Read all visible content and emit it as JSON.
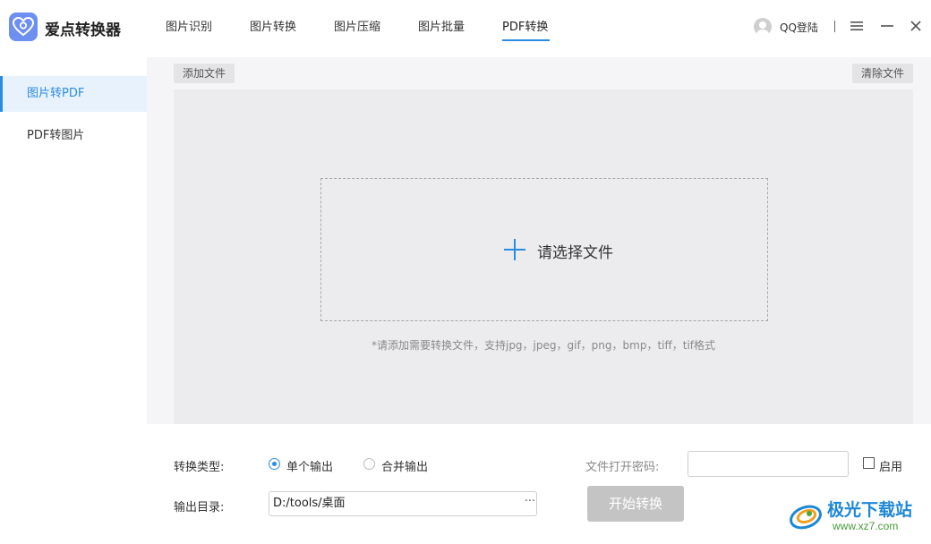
{
  "app": {
    "name": "爱点转换器",
    "brand_color": "#6c8ff0"
  },
  "nav": {
    "items": [
      {
        "label": "图片识别"
      },
      {
        "label": "图片转换"
      },
      {
        "label": "图片压缩"
      },
      {
        "label": "图片批量"
      },
      {
        "label": "PDF转换"
      }
    ],
    "active_index": 4,
    "accent_color": "#2a8ce0"
  },
  "header": {
    "login_label": "QQ登陆",
    "icons": [
      "user-avatar-icon",
      "menu-icon",
      "minimize-icon",
      "close-icon"
    ]
  },
  "sidebar": {
    "items": [
      {
        "label": "图片转PDF",
        "active": true
      },
      {
        "label": "PDF转图片",
        "active": false
      }
    ]
  },
  "toolbar": {
    "add_label": "添加文件",
    "clear_label": "清除文件"
  },
  "dropzone": {
    "choose_label": "请选择文件",
    "hint": "*请添加需要转换文件，支持jpg，jpeg，gif，png，bmp，tiff，tif格式"
  },
  "form": {
    "convert_type_label": "转换类型:",
    "options": [
      {
        "label": "单个输出",
        "checked": true
      },
      {
        "label": "合并输出",
        "checked": false
      }
    ],
    "password_label": "文件打开密码:",
    "password_value": "",
    "enable_label": "启用",
    "enable_checked": false,
    "output_dir_label": "输出目录:",
    "output_dir_value": "D:/tools/桌面",
    "browse_label": "···",
    "start_label": "开始转换"
  },
  "watermark": {
    "title": "极光下载站",
    "url": "www.xz7.com"
  }
}
